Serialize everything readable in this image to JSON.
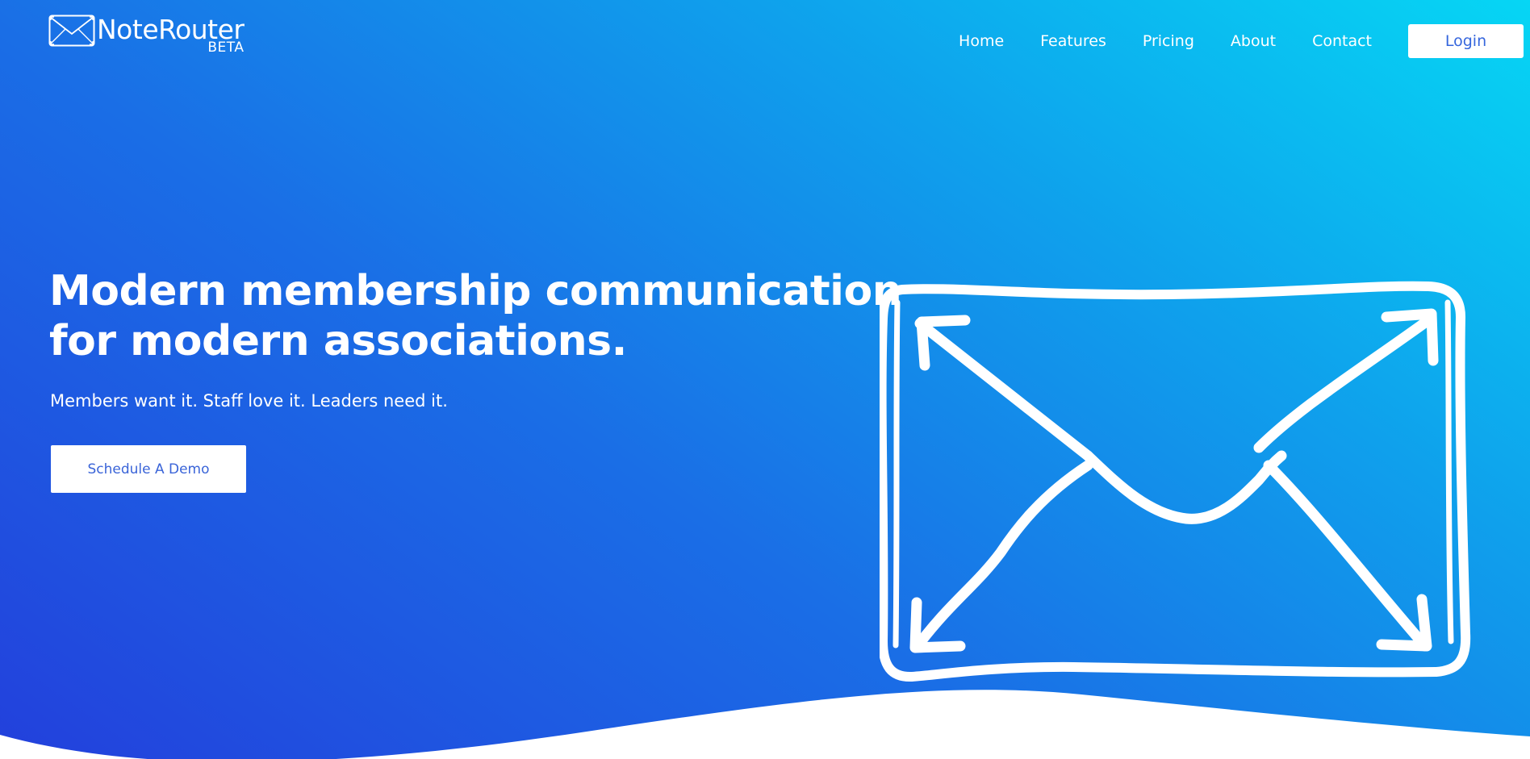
{
  "header": {
    "logo": {
      "name": "NoteRouter",
      "badge": "BETA",
      "icon": "envelope-icon"
    },
    "nav": [
      {
        "label": "Home"
      },
      {
        "label": "Features"
      },
      {
        "label": "Pricing"
      },
      {
        "label": "About"
      },
      {
        "label": "Contact"
      }
    ],
    "login_label": "Login"
  },
  "hero": {
    "headline_line1": "Modern membership communication",
    "headline_line2": "for modern associations.",
    "subheadline": "Members want it. Staff love it. Leaders need it.",
    "cta_label": "Schedule A Demo",
    "illustration": "envelope-arrows-icon"
  },
  "colors": {
    "gradient_start": "#2340dc",
    "gradient_end": "#06d6f4",
    "button_text": "#3566dd",
    "text": "#ffffff"
  }
}
